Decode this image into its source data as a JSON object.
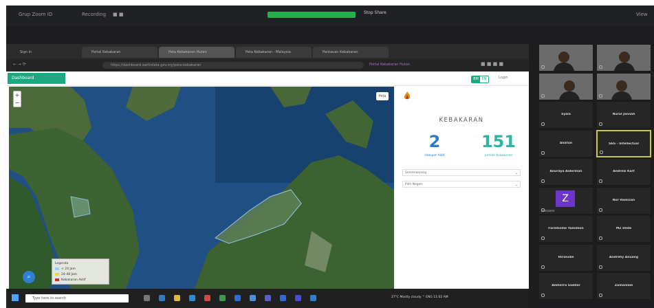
{
  "zoom": {
    "tabs": [
      "Grup Zoom ID",
      "Recording"
    ],
    "share_banner": "",
    "share_text": "Stop Share",
    "corner_text": "View"
  },
  "browser": {
    "tabs": [
      "Sign in",
      "Portal Kebakaran",
      "Peta Kebakaran Hutan",
      "Peta Kebakaran - Malaysia",
      "Pantauan Kebakaran"
    ],
    "url": "https://dashboard.earthdata.gov.my/peta-kebakaran",
    "extra": "Portal Kebakaran Hutan"
  },
  "app": {
    "logo": "Dashboard",
    "lang": [
      "BM",
      "EN"
    ],
    "login": "Login",
    "map_button": "Peta",
    "legend": [
      "< 24 Jam",
      "24-48 Jam",
      "Kebakaran Aktif"
    ],
    "legend_title": "Legenda",
    "panel_title": "KEBAKARAN",
    "stat1_value": "2",
    "stat1_label": "Hotspot Aktif",
    "stat2_value": "151",
    "stat2_label": "Jumlah Kebakaran",
    "select1": "Semenanjung",
    "select2": "Pilih Negeri",
    "colors": {
      "brand": "#1aa980",
      "stat1": "#2f7cc6",
      "stat2": "#2fb5a4"
    }
  },
  "taskbar": {
    "search": "Type here to search",
    "tray": "27°C  Mostly cloudy  ^  ENG  11:02 AM"
  },
  "participants": [
    {
      "name": "",
      "video": true
    },
    {
      "name": "",
      "video": true
    },
    {
      "name": "",
      "video": true
    },
    {
      "name": "",
      "video": true
    },
    {
      "name": "Syala",
      "video": false
    },
    {
      "name": "Nurul Jannah",
      "video": false
    },
    {
      "name": "Anatun",
      "video": false
    },
    {
      "name": "SEG - Intellectual",
      "video": false,
      "active": true
    },
    {
      "name": "Anuraya Aiderman",
      "video": false
    },
    {
      "name": "Andrew Kart",
      "video": false
    },
    {
      "name": "zamzamir",
      "video": false,
      "avatar": "Z"
    },
    {
      "name": "Nor Hamizan",
      "video": false
    },
    {
      "name": "Farmhome Yamimon",
      "video": false
    },
    {
      "name": "MZ Dede",
      "video": false
    },
    {
      "name": "Hiranoke",
      "video": false
    },
    {
      "name": "Andrehy Anuang",
      "video": false
    },
    {
      "name": "Amherra Saddar",
      "video": false
    },
    {
      "name": "Zamanlaie",
      "video": false
    }
  ]
}
